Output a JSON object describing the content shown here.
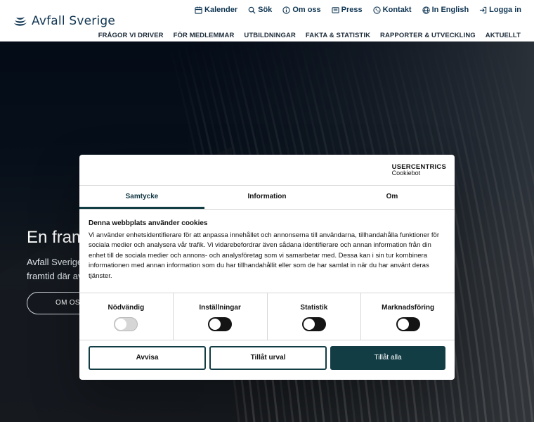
{
  "header": {
    "logo_text": "Avfall Sverige",
    "utility": [
      {
        "label": "Kalender",
        "icon": "calendar-icon"
      },
      {
        "label": "Sök",
        "icon": "search-icon"
      },
      {
        "label": "Om oss",
        "icon": "info-icon"
      },
      {
        "label": "Press",
        "icon": "newspaper-icon"
      },
      {
        "label": "Kontakt",
        "icon": "phone-icon"
      },
      {
        "label": "In English",
        "icon": "globe-icon"
      },
      {
        "label": "Logga in",
        "icon": "login-icon"
      }
    ],
    "nav": [
      "FRÅGOR VI DRIVER",
      "FÖR MEDLEMMAR",
      "UTBILDNINGAR",
      "FAKTA & STATISTIK",
      "RAPPORTER & UTVECKLING",
      "AKTUELLT"
    ]
  },
  "hero": {
    "title": "En fram",
    "subtitle_1": "Avfall Sverige",
    "subtitle_2": "framtid där av",
    "button": "OM OSS"
  },
  "cookie": {
    "brand_main": "USERCENTRICS",
    "brand_sub": "Cookiebot",
    "tabs": [
      "Samtycke",
      "Information",
      "Om"
    ],
    "active_tab": "Samtycke",
    "heading": "Denna webbplats använder cookies",
    "text": "Vi använder enhetsidentifierare för att anpassa innehållet och annonserna till användarna, tillhandahålla funktioner för sociala medier och analysera vår trafik. Vi vidarebefordrar även sådana identifierare och annan information från din enhet till de sociala medier och annons- och analysföretag som vi samarbetar med. Dessa kan i sin tur kombinera informationen med annan information som du har tillhandahållit eller som de har samlat in när du har använt deras tjänster.",
    "categories": [
      {
        "label": "Nödvändig",
        "state": "on-disabled"
      },
      {
        "label": "Inställningar",
        "state": "off"
      },
      {
        "label": "Statistik",
        "state": "off"
      },
      {
        "label": "Marknadsföring",
        "state": "off"
      }
    ],
    "buttons": {
      "reject": "Avvisa",
      "selection": "Tillåt urval",
      "all": "Tillåt alla"
    },
    "colors": {
      "accent": "#123d45",
      "text": "#141414"
    }
  }
}
